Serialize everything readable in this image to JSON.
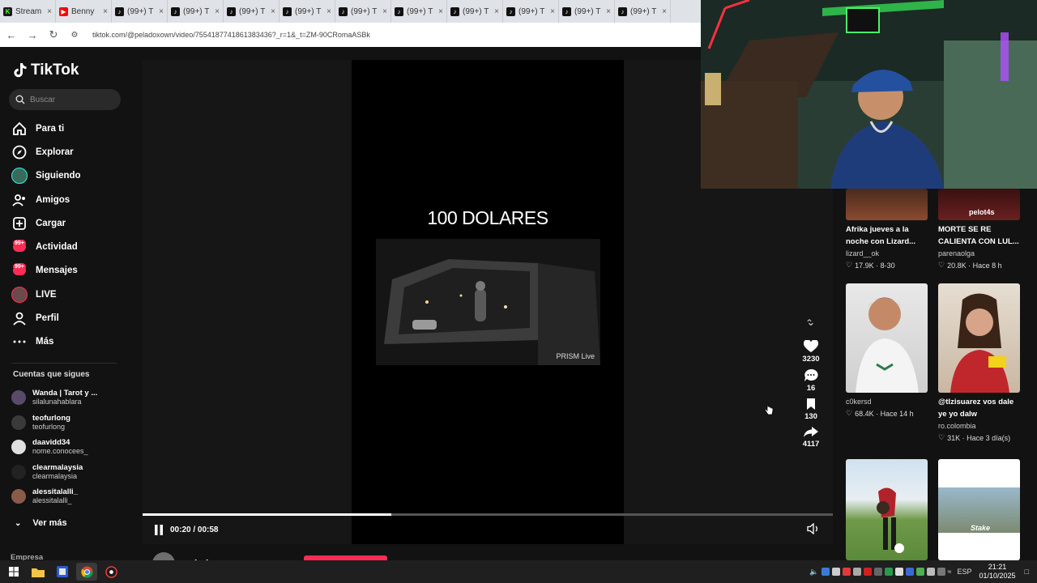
{
  "browser": {
    "tabs": [
      {
        "label": "Stream",
        "icon": "kick-icon"
      },
      {
        "label": "Benny",
        "icon": "youtube-icon"
      },
      {
        "label": "(99+) T",
        "icon": "tiktok-icon"
      },
      {
        "label": "(99+) T",
        "icon": "tiktok-icon"
      },
      {
        "label": "(99+) T",
        "icon": "tiktok-icon"
      },
      {
        "label": "(99+) T",
        "icon": "tiktok-icon"
      },
      {
        "label": "(99+) T",
        "icon": "tiktok-icon"
      },
      {
        "label": "(99+) T",
        "icon": "tiktok-icon"
      },
      {
        "label": "(99+) T",
        "icon": "tiktok-icon"
      },
      {
        "label": "(99+) T",
        "icon": "tiktok-icon"
      },
      {
        "label": "(99+) T",
        "icon": "tiktok-icon"
      },
      {
        "label": "(99+) T",
        "icon": "tiktok-icon"
      }
    ],
    "tab_close": "×",
    "url": "tiktok.com/@peladoxown/video/7554187741861383436?_r=1&_t=ZM-90CRomaASBk"
  },
  "sidebar": {
    "logo": "TikTok",
    "search_placeholder": "Buscar",
    "nav": [
      {
        "label": "Para ti",
        "icon": "home-icon"
      },
      {
        "label": "Explorar",
        "icon": "compass-icon"
      },
      {
        "label": "Siguiendo",
        "icon": "following-avatar-icon"
      },
      {
        "label": "Amigos",
        "icon": "friends-icon"
      },
      {
        "label": "Cargar",
        "icon": "upload-icon"
      },
      {
        "label": "Actividad",
        "icon": "activity-icon",
        "badge": "99+"
      },
      {
        "label": "Mensajes",
        "icon": "messages-icon",
        "badge": "99+"
      },
      {
        "label": "LIVE",
        "icon": "live-icon"
      },
      {
        "label": "Perfil",
        "icon": "profile-icon"
      },
      {
        "label": "Más",
        "icon": "more-icon"
      }
    ],
    "following_title": "Cuentas que sigues",
    "following": [
      {
        "name": "Wanda | Tarot y ...",
        "user": "silalunahablara"
      },
      {
        "name": "teofurlong",
        "user": "teofurlong"
      },
      {
        "name": "daavidd34",
        "user": "nome.conocees_"
      },
      {
        "name": "clearmalaysia",
        "user": "clearmalaysia"
      },
      {
        "name": "alessitalalli_",
        "user": "alessitalalli_"
      }
    ],
    "see_more": "Ver más",
    "company": "Empresa"
  },
  "video": {
    "overlay_title": "100 DOLARES",
    "watermark": "PRISM Live",
    "time": "00:20 / 00:58",
    "progress": 0.36,
    "author": "peladoxown",
    "likes": "3230",
    "comments": "16",
    "saves": "130",
    "shares": "4117"
  },
  "grid": [
    {
      "title": "Afrika jueves a la noche con Lizard...",
      "user": "lizard__ok",
      "meta": "17.9K · 8-30"
    },
    {
      "title": "MORTE SE RE CALIENTA CON LUL...",
      "user": "parenaolga",
      "meta": "20.8K · Hace 8 h"
    },
    {
      "title": "",
      "user": "c0kersd",
      "meta": "68.4K · Hace 14 h"
    },
    {
      "title": "@tlzisuarez vos dale ye yo dalw",
      "user": "ro.colombia",
      "meta": "31K · Hace 3 día(s)"
    }
  ],
  "thumb_text": {
    "top_right": "pelot4s",
    "bottom_right": "Stake"
  },
  "taskbar": {
    "language": "ESP",
    "time": "21:21",
    "date": "01/10/2025"
  },
  "colors": {
    "accent": "#fe2c55",
    "background": "#121212",
    "kick": "#53fc18"
  }
}
